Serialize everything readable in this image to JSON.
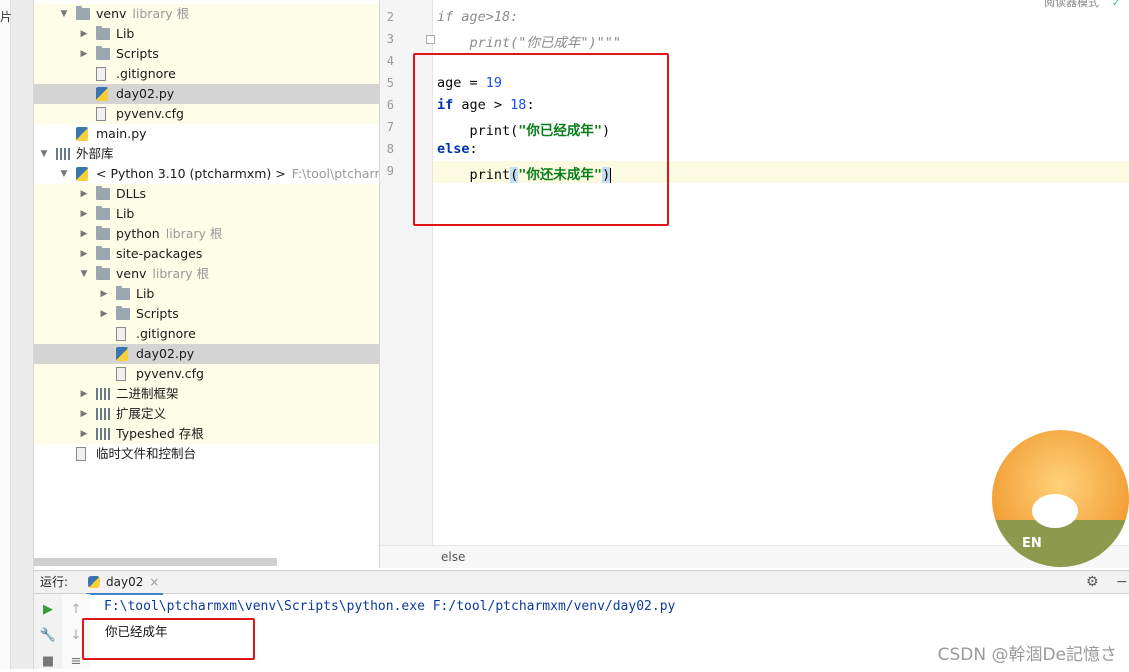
{
  "left_strip_char": "片",
  "project_tree": [
    {
      "indent": 1,
      "arrow": "down",
      "icon": "folder-icon",
      "label": "venv",
      "hint": "library 根",
      "bg": "yellow"
    },
    {
      "indent": 2,
      "arrow": "right",
      "icon": "folder-icon",
      "label": "Lib",
      "hint": "",
      "bg": "yellow"
    },
    {
      "indent": 2,
      "arrow": "right",
      "icon": "folder-icon",
      "label": "Scripts",
      "hint": "",
      "bg": "yellow"
    },
    {
      "indent": 2,
      "arrow": "",
      "icon": "file-icon",
      "label": ".gitignore",
      "hint": "",
      "bg": "yellow"
    },
    {
      "indent": 2,
      "arrow": "",
      "icon": "python-file-icon",
      "label": "day02.py",
      "hint": "",
      "bg": "selected"
    },
    {
      "indent": 2,
      "arrow": "",
      "icon": "file-icon",
      "label": "pyvenv.cfg",
      "hint": "",
      "bg": "yellow"
    },
    {
      "indent": 1,
      "arrow": "",
      "icon": "python-file-icon",
      "label": "main.py",
      "hint": "",
      "bg": ""
    },
    {
      "indent": 0,
      "arrow": "down",
      "icon": "libraries-icon",
      "label": "外部库",
      "hint": "",
      "bg": ""
    },
    {
      "indent": 1,
      "arrow": "down",
      "icon": "python-icon",
      "label": "< Python 3.10 (ptcharmxm) >",
      "hint": "F:\\tool\\ptcharmxm",
      "bg": ""
    },
    {
      "indent": 2,
      "arrow": "right",
      "icon": "folder-icon",
      "label": "DLLs",
      "hint": "",
      "bg": "yellow"
    },
    {
      "indent": 2,
      "arrow": "right",
      "icon": "folder-icon",
      "label": "Lib",
      "hint": "",
      "bg": "yellow"
    },
    {
      "indent": 2,
      "arrow": "right",
      "icon": "folder-icon",
      "label": "python",
      "hint": "library 根",
      "bg": "yellow"
    },
    {
      "indent": 2,
      "arrow": "right",
      "icon": "folder-icon",
      "label": "site-packages",
      "hint": "",
      "bg": "yellow"
    },
    {
      "indent": 2,
      "arrow": "down",
      "icon": "folder-icon",
      "label": "venv",
      "hint": "library 根",
      "bg": "yellow"
    },
    {
      "indent": 3,
      "arrow": "right",
      "icon": "folder-icon",
      "label": "Lib",
      "hint": "",
      "bg": "yellow"
    },
    {
      "indent": 3,
      "arrow": "right",
      "icon": "folder-icon",
      "label": "Scripts",
      "hint": "",
      "bg": "yellow"
    },
    {
      "indent": 3,
      "arrow": "",
      "icon": "file-icon",
      "label": ".gitignore",
      "hint": "",
      "bg": "yellow"
    },
    {
      "indent": 3,
      "arrow": "",
      "icon": "python-file-icon",
      "label": "day02.py",
      "hint": "",
      "bg": "selected"
    },
    {
      "indent": 3,
      "arrow": "",
      "icon": "file-icon",
      "label": "pyvenv.cfg",
      "hint": "",
      "bg": "yellow"
    },
    {
      "indent": 2,
      "arrow": "right",
      "icon": "libraries-icon",
      "label": "二进制框架",
      "hint": "",
      "bg": "yellow"
    },
    {
      "indent": 2,
      "arrow": "right",
      "icon": "libraries-icon",
      "label": "扩展定义",
      "hint": "",
      "bg": "yellow"
    },
    {
      "indent": 2,
      "arrow": "right",
      "icon": "libraries-icon",
      "label": "Typeshed 存根",
      "hint": "",
      "bg": "yellow"
    },
    {
      "indent": 1,
      "arrow": "",
      "icon": "scratches-icon",
      "label": "临时文件和控制台",
      "hint": "",
      "bg": ""
    }
  ],
  "editor": {
    "top_right_hint": "阅读器模式",
    "lines": [
      {
        "num": "2",
        "parts": [
          {
            "t": "if age>18:",
            "c": "cmt"
          }
        ]
      },
      {
        "num": "3",
        "parts": [
          {
            "t": "    print(\"你已成年\")\"\"\"",
            "c": "cmt"
          }
        ]
      },
      {
        "num": "4",
        "parts": []
      },
      {
        "num": "5",
        "parts": [
          {
            "t": "age = ",
            "c": ""
          },
          {
            "t": "19",
            "c": "num"
          }
        ]
      },
      {
        "num": "6",
        "parts": [
          {
            "t": "if",
            "c": "kw"
          },
          {
            "t": " age > ",
            "c": ""
          },
          {
            "t": "18",
            "c": "num"
          },
          {
            "t": ":",
            "c": ""
          }
        ]
      },
      {
        "num": "7",
        "parts": [
          {
            "t": "    print(",
            "c": ""
          },
          {
            "t": "\"你已经成年\"",
            "c": "str"
          },
          {
            "t": ")",
            "c": ""
          }
        ]
      },
      {
        "num": "8",
        "parts": [
          {
            "t": "else",
            "c": "kw"
          },
          {
            "t": ":",
            "c": ""
          }
        ]
      },
      {
        "num": "9",
        "parts": [
          {
            "t": "    print",
            "c": ""
          },
          {
            "t": "(",
            "c": "paren"
          },
          {
            "t": "\"你还未成年\"",
            "c": "str"
          },
          {
            "t": ")",
            "c": "paren"
          }
        ]
      }
    ],
    "breadcrumb": "else"
  },
  "run": {
    "label": "运行:",
    "tab": "day02",
    "tab_close": "×",
    "command": "F:\\tool\\ptcharmxm\\venv\\Scripts\\python.exe F:/tool/ptcharmxm/venv/day02.py",
    "output": "你已经成年",
    "avatar_text": "EN"
  },
  "watermark": "CSDN @幹涸De記憶さ"
}
